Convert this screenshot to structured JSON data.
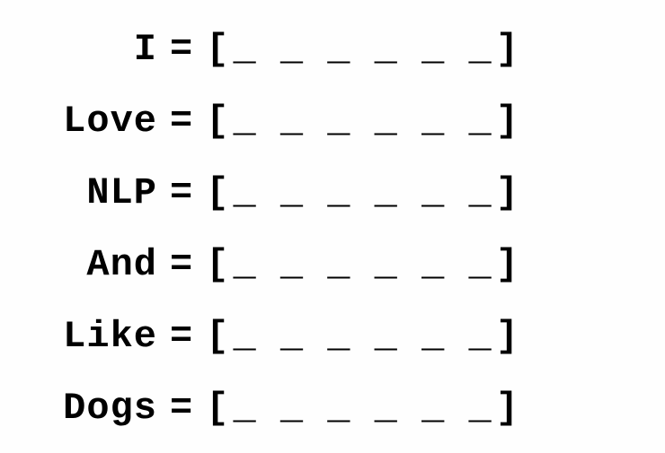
{
  "rows": [
    {
      "label": "I",
      "blanks": "_ _ _ _ _ _"
    },
    {
      "label": "Love",
      "blanks": "_ _ _ _ _ _"
    },
    {
      "label": "NLP",
      "blanks": "_ _ _ _ _ _"
    },
    {
      "label": "And",
      "blanks": "_ _ _ _ _ _"
    },
    {
      "label": "Like",
      "blanks": "_ _ _ _ _ _"
    },
    {
      "label": "Dogs",
      "blanks": "_ _ _ _ _ _"
    }
  ],
  "symbols": {
    "equals": "=",
    "open": "[",
    "close": "]"
  }
}
